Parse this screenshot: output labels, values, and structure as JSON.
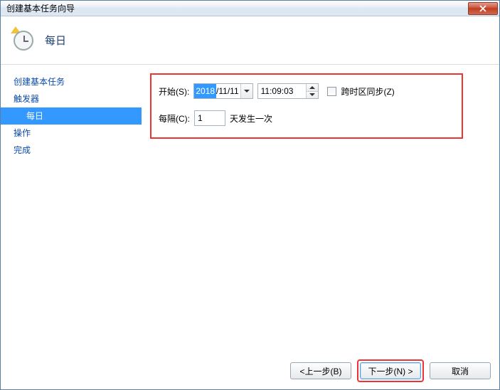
{
  "window": {
    "title": "创建基本任务向导"
  },
  "header": {
    "title": "每日"
  },
  "sidebar": {
    "items": [
      {
        "label": "创建基本任务",
        "sub": false,
        "selected": false
      },
      {
        "label": "触发器",
        "sub": false,
        "selected": false
      },
      {
        "label": "每日",
        "sub": true,
        "selected": true
      },
      {
        "label": "操作",
        "sub": false,
        "selected": false
      },
      {
        "label": "完成",
        "sub": false,
        "selected": false
      }
    ]
  },
  "form": {
    "start_label": "开始(S):",
    "date_year": "2018",
    "date_rest": "/11/11",
    "time_value": "11:09:03",
    "sync_label": "跨时区同步(Z)",
    "recur_label": "每隔(C):",
    "recur_value": "1",
    "recur_suffix": "天发生一次"
  },
  "buttons": {
    "back": "<上一步(B)",
    "next": "下一步(N) >",
    "cancel": "取消"
  }
}
